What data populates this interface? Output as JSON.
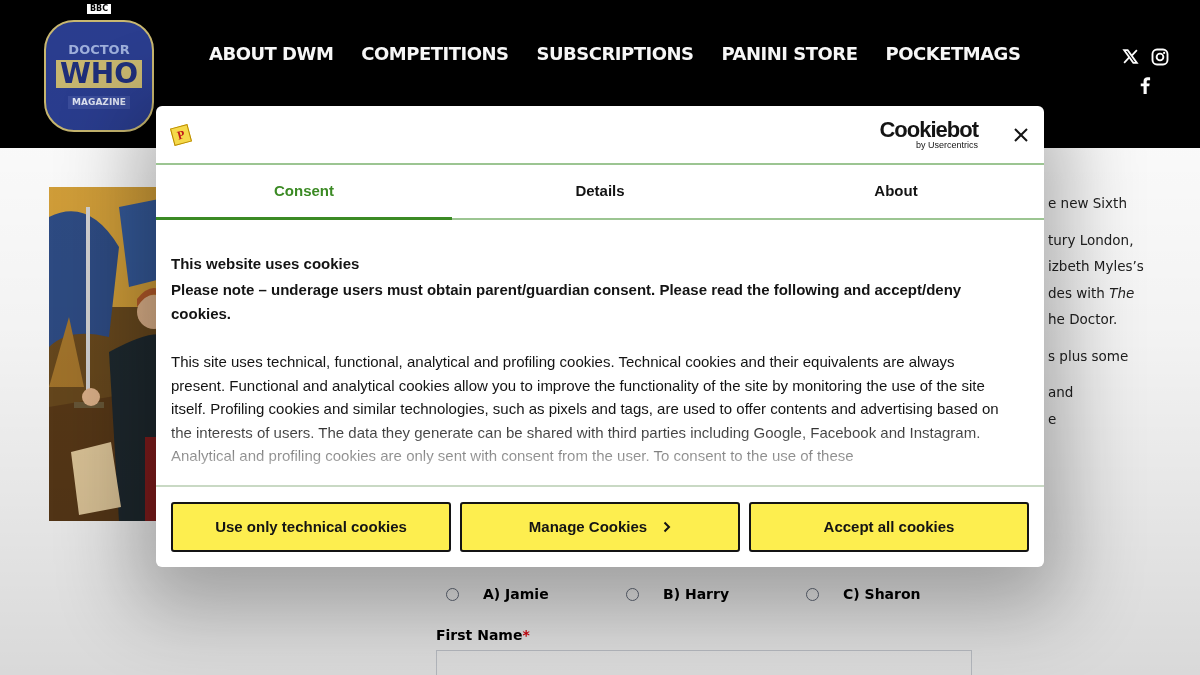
{
  "header": {
    "logo": {
      "top": "BBC",
      "line1": "DOCTOR",
      "line2": "WHO",
      "line3": "MAGAZINE"
    },
    "nav": [
      {
        "label": "ABOUT DWM"
      },
      {
        "label": "COMPETITIONS"
      },
      {
        "label": "SUBSCRIPTIONS"
      },
      {
        "label": "PANINI STORE"
      },
      {
        "label": "POCKETMAGS"
      }
    ]
  },
  "article": {
    "paragraphs": [
      [
        "e new Sixth"
      ],
      [
        "tury London,",
        "izbeth Myles’s",
        "des with *The*",
        "he Doctor."
      ],
      [
        "s plus some"
      ],
      [
        "and",
        "e"
      ]
    ]
  },
  "quiz": {
    "options": [
      {
        "label": "A) Jamie",
        "selected": false
      },
      {
        "label": "B) Harry",
        "selected": false
      },
      {
        "label": "C) Sharon",
        "selected": false
      }
    ],
    "first_name": {
      "label": "First Name",
      "required": true,
      "required_mark": "*"
    }
  },
  "cookie_dialog": {
    "publisher_logo": "P",
    "brand": "Cookiebot",
    "brand_sub": "by Usercentrics",
    "tabs": [
      {
        "label": "Consent",
        "selected": true
      },
      {
        "label": "Details",
        "selected": false
      },
      {
        "label": "About",
        "selected": false
      }
    ],
    "heading": "This website uses cookies",
    "note": "Please note – underage users must obtain parent/guardian consent. Please read the following and accept/deny cookies.",
    "body": "This site uses technical, functional, analytical and profiling cookies. Technical cookies and their equivalents are always present.  Functional and analytical cookies allow you to improve the functionality of the site by monitoring the use of the site itself.  Profiling cookies and similar technologies, such as pixels and tags, are used to offer contents and advertising based on the interests of users.  The data they generate can be shared with third parties including Google, Facebook and Instagram. Analytical and profiling cookies are only sent with consent from the user.  To consent to the use of these",
    "buttons": [
      {
        "label": "Use only technical cookies",
        "kind": "plain"
      },
      {
        "label": "Manage Cookies",
        "kind": "chevron"
      },
      {
        "label": "Accept all cookies",
        "kind": "plain"
      }
    ]
  }
}
